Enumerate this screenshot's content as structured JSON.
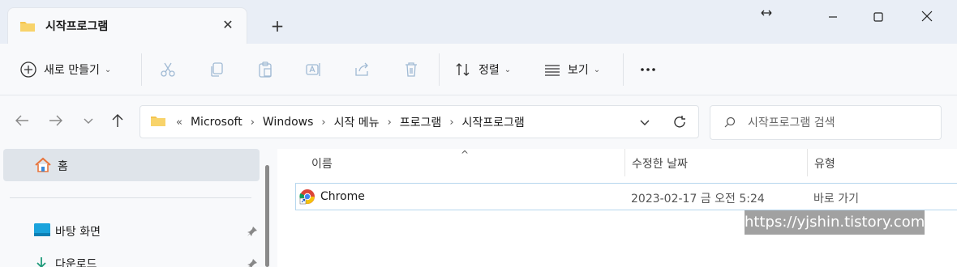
{
  "tab": {
    "title": "시작프로그램"
  },
  "toolbar": {
    "new_label": "새로 만들기",
    "sort_label": "정렬",
    "view_label": "보기"
  },
  "breadcrumb": {
    "overflow": "«",
    "items": [
      "Microsoft",
      "Windows",
      "시작 메뉴",
      "프로그램",
      "시작프로그램"
    ]
  },
  "search": {
    "placeholder": "시작프로그램 검색"
  },
  "sidebar": {
    "home": "홈",
    "items": [
      {
        "label": "바탕 화면"
      },
      {
        "label": "다운로드"
      }
    ]
  },
  "columns": {
    "name": "이름",
    "date": "수정한 날짜",
    "type": "유형"
  },
  "files": [
    {
      "name": "Chrome",
      "date": "2023-02-17 금 오전 5:24",
      "type": "바로 가기"
    }
  ],
  "watermark": "https://yjshin.tistory.com",
  "colors": {
    "accent": "#0067c0",
    "selection_border": "#b7d7ee",
    "folder": "#f4c44e"
  },
  "icons": [
    "folder-icon",
    "close-icon",
    "plus-icon",
    "maximize-icon",
    "cut-icon",
    "copy-icon",
    "paste-icon",
    "rename-icon",
    "share-icon",
    "delete-icon",
    "sort-icon",
    "view-icon",
    "more-icon",
    "back-icon",
    "forward-icon",
    "up-icon",
    "refresh-icon",
    "search-icon",
    "home-icon",
    "desktop-icon",
    "download-icon",
    "pin-icon",
    "chrome-icon"
  ]
}
